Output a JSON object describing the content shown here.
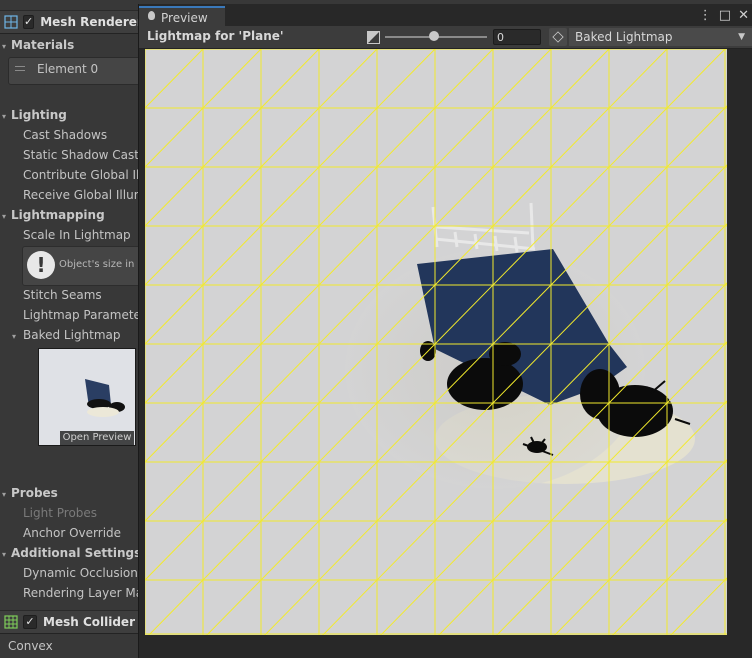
{
  "inspector": {
    "mesh_renderer": {
      "title": "Mesh Renderer",
      "checked": "✓"
    },
    "materials": {
      "label": "Materials",
      "element": "Element 0"
    },
    "lighting": {
      "label": "Lighting",
      "cast_shadows": "Cast Shadows",
      "static_shadow": "Static Shadow Caster",
      "contribute_gi": "Contribute Global Illumination",
      "receive_gi": "Receive Global Illumination"
    },
    "lightmapping": {
      "label": "Lightmapping",
      "scale": "Scale In Lightmap",
      "help_text": "Object's size in lightmap",
      "stitch": "Stitch Seams",
      "params": "Lightmap Parameters",
      "baked": "Baked Lightmap",
      "open_preview": "Open Preview"
    },
    "probes": {
      "label": "Probes",
      "light_probes": "Light Probes",
      "anchor": "Anchor Override"
    },
    "additional": {
      "label": "Additional Settings",
      "dynamic_occlusion": "Dynamic Occlusion",
      "rendering_layer": "Rendering Layer Mask"
    },
    "mesh_collider": {
      "title": "Mesh Collider",
      "checked": "✓"
    },
    "convex": "Convex"
  },
  "preview": {
    "tab": "Preview",
    "title": "Lightmap for 'Plane'",
    "exposure_value": "0",
    "exposure_level": 0.48,
    "mode": "Baked Lightmap",
    "controls": {
      "menu": "⋮",
      "maximize": "□",
      "close": "✕"
    }
  },
  "colors": {
    "wireframe": "#f2ea2c",
    "tab_accent": "#3a79bb",
    "object": "#1c2e4c"
  }
}
